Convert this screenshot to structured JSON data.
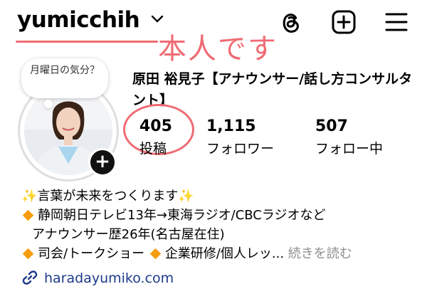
{
  "header": {
    "username": "yumicchih",
    "annotation": "本人です"
  },
  "note": {
    "text": "月曜日の気分？"
  },
  "profile": {
    "display_name": "原田 裕見子【アナウンサー/話し方コンサルタント】"
  },
  "stats": [
    {
      "value": "405",
      "label": "投稿"
    },
    {
      "value": "1,115",
      "label": "フォロワー"
    },
    {
      "value": "507",
      "label": "フォロー中"
    }
  ],
  "bio": {
    "line1": "✨言葉が未来をつくります✨",
    "line2": "静岡朝日テレビ13年→東海ラジオ/CBCラジオなど",
    "line3": "アナウンサー歴26年(名古屋在住)",
    "line4a": "司会/トークショー",
    "line4b": "企業研修/個人レッ...",
    "more": "続きを読む"
  },
  "link": {
    "text": "haradayumiko.com"
  },
  "colors": {
    "accent": "#ef6b73",
    "diamond": "#f59d0f",
    "link": "#1e3a8a"
  },
  "icons": [
    "chevron-down-icon",
    "threads-icon",
    "plus-square-icon",
    "menu-icon",
    "link-icon",
    "add-story-icon"
  ]
}
